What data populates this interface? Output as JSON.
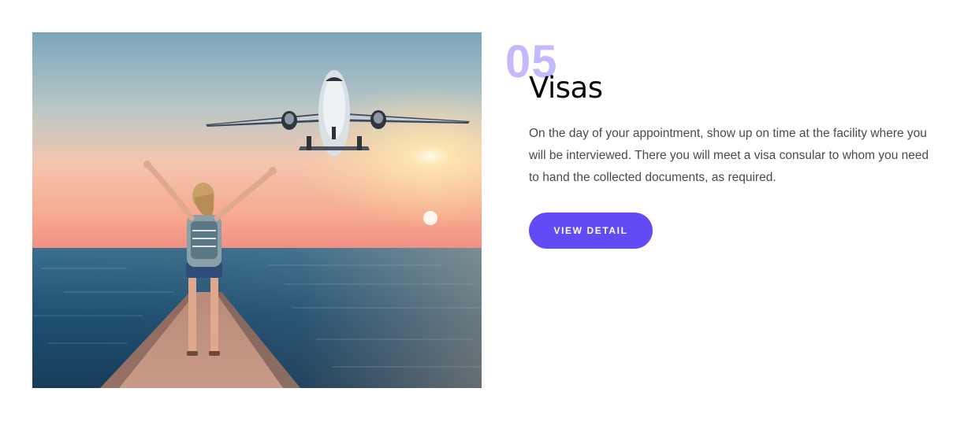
{
  "card": {
    "image_alt": "Woman on a pier with raised arms watching an airplane fly over the sea at sunset",
    "step_number": "05",
    "title": "Visas",
    "description": "On the day of your appointment, show up on time at the facility where you will be interviewed. There you will meet a visa consular to whom you need to hand the collected documents, as required.",
    "button_label": "VIEW DETAIL"
  },
  "colors": {
    "accent": "#624bf5",
    "step_number": "#c2bbfb",
    "title": "#0a0a0a",
    "body_text": "#4a4a4a"
  }
}
